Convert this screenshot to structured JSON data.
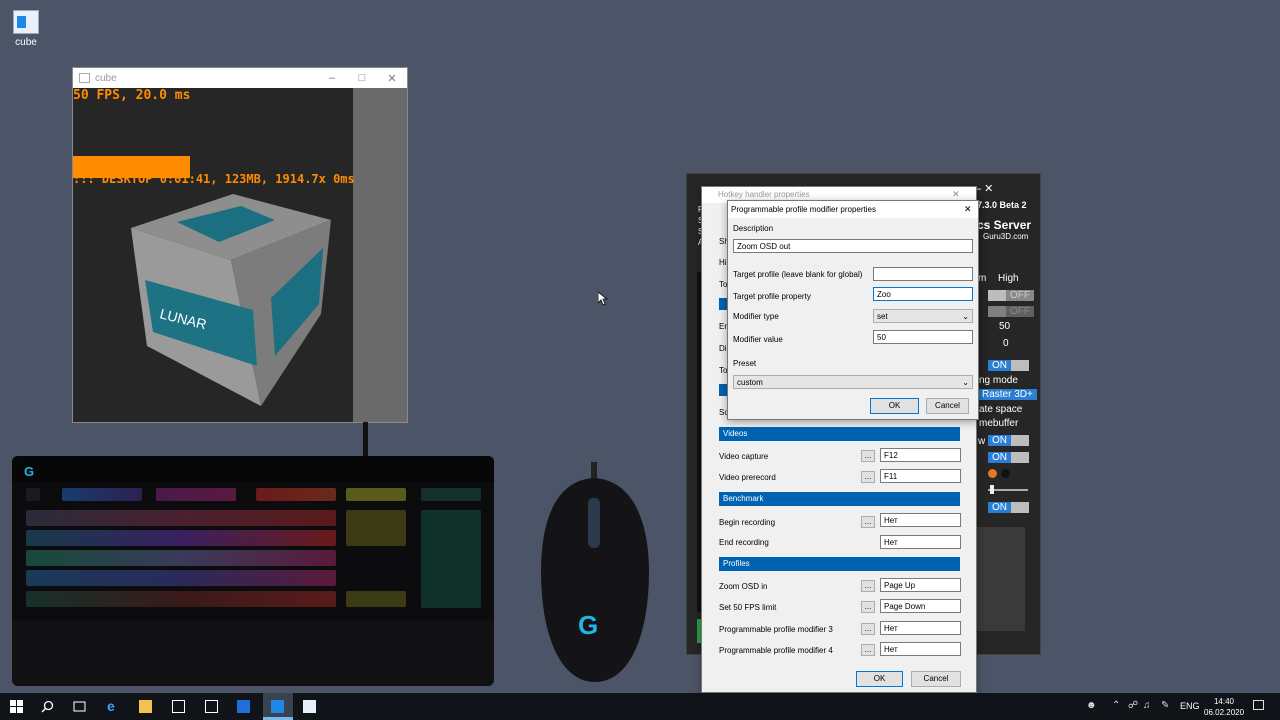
{
  "desktop": {
    "icon_label": "cube"
  },
  "cube_window": {
    "title": "cube",
    "osd_fps": "50 FPS, 20.0 ms",
    "osd_desktop": "::: DESKTOP 0:01:41, 123MB, 1914.7x 0ms",
    "cube_logo": "LUNAR G"
  },
  "rtss": {
    "version": "7.3.0 Beta 2",
    "server": "cs Server",
    "site": "Guru3D.com",
    "col_low_partial": "m",
    "col_high": "High",
    "toggle_off": "OFF",
    "value_50": "50",
    "value_0": "0",
    "toggle_on": "ON",
    "ng_mode": "ng mode",
    "raster": "Raster 3D+",
    "ate_space": "ate space",
    "mebuffer": "mebuffer",
    "partial_w": "w",
    "behind_letters": [
      "R",
      "S",
      "S",
      "A",
      "H",
      "T",
      "F",
      "E",
      "D",
      "T",
      "S",
      "S"
    ]
  },
  "hotkey_dialog": {
    "title": "Hotkey handler properties",
    "sections": {
      "videos": "Videos",
      "benchmark": "Benchmark",
      "profiles": "Profiles"
    },
    "rows": [
      {
        "label": "Video capture",
        "value": "F12"
      },
      {
        "label": "Video prerecord",
        "value": "F11"
      },
      {
        "label": "Begin recording",
        "value": "Нет"
      },
      {
        "label": "End recording",
        "value": "Нет"
      },
      {
        "label": "Zoom OSD in",
        "value": "Page Up"
      },
      {
        "label": "Set 50 FPS limit",
        "value": "Page Down"
      },
      {
        "label": "Programmable profile modifier 3",
        "value": "Нет"
      },
      {
        "label": "Programmable profile modifier 4",
        "value": "Нет"
      }
    ],
    "dots": "...",
    "ok": "OK",
    "cancel": "Cancel"
  },
  "modifier_dialog": {
    "title": "Programmable profile modifier properties",
    "description_label": "Description",
    "description_value": "Zoom OSD out",
    "target_profile_label": "Target profile (leave blank for global)",
    "target_profile_value": "",
    "target_property_label": "Target profile property",
    "target_property_value": "Zoo",
    "modifier_type_label": "Modifier type",
    "modifier_type_value": "set",
    "modifier_value_label": "Modifier value",
    "modifier_value_value": "50",
    "preset_label": "Preset",
    "preset_value": "custom",
    "ok": "OK",
    "cancel": "Cancel"
  },
  "taskbar": {
    "lang": "ENG",
    "time": "14:40",
    "date": "06.02.2020"
  },
  "colors": {
    "accent": "#0063b1",
    "osd_orange": "#ff8c00",
    "desktop": "#4c5468"
  }
}
